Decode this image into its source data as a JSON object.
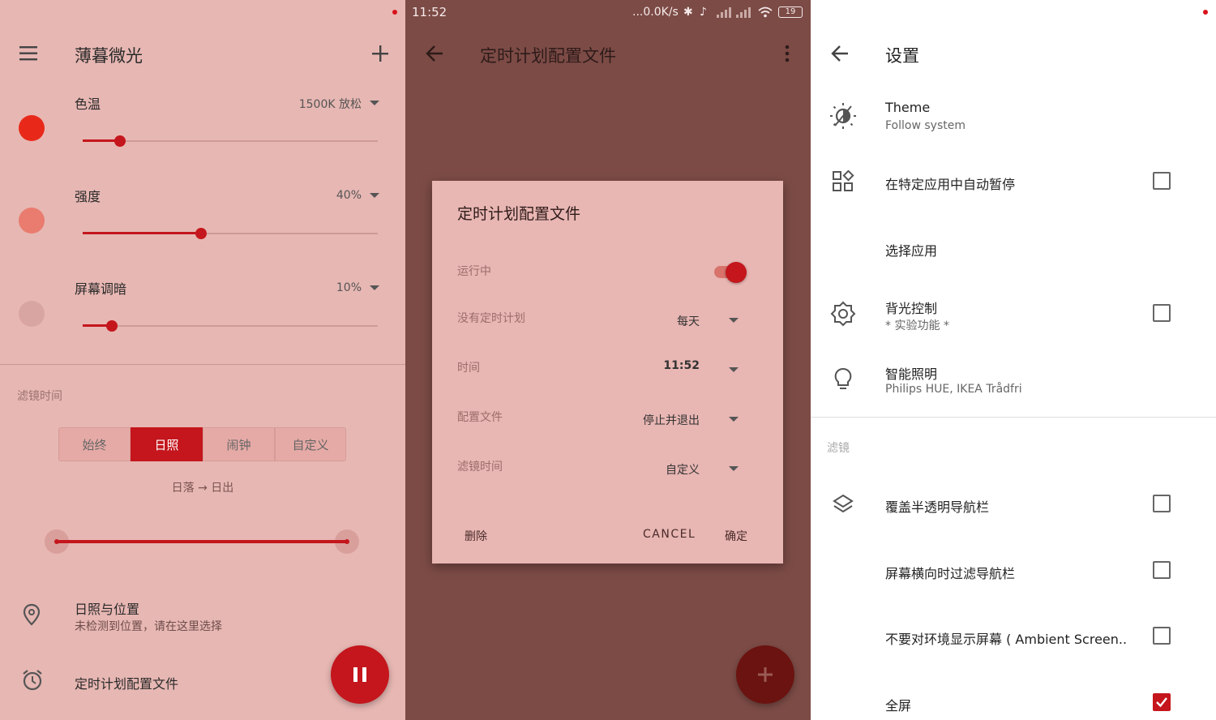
{
  "p1": {
    "title": "薄暮微光",
    "sliders": [
      {
        "label": "色温",
        "value": "1500K 放松",
        "level": 0.125,
        "color": "#e8291a"
      },
      {
        "label": "强度",
        "value": "40%",
        "level": 0.4,
        "color": "#e97c6f"
      },
      {
        "label": "屏幕调暗",
        "value": "10%",
        "level": 0.1,
        "color": "#d9a5a2"
      }
    ],
    "filter_time_label": "滤镜时间",
    "segments": [
      "始终",
      "日照",
      "闹钟",
      "自定义"
    ],
    "selected_segment": "日照",
    "range_text": "日落 → 日出",
    "location_title": "日照与位置",
    "location_sub": "未检测到位置，请在这里选择",
    "schedule_title": "定时计划配置文件"
  },
  "p2": {
    "status": {
      "time": "11:52",
      "net": "...0.0K/s",
      "battery": "19"
    },
    "title": "定时计划配置文件",
    "dialog": {
      "title": "定时计划配置文件",
      "rows": [
        {
          "label": "运行中",
          "value": ""
        },
        {
          "label": "没有定时计划",
          "value": "每天"
        },
        {
          "label": "时间",
          "value": "11:52"
        },
        {
          "label": "配置文件",
          "value": "停止并退出"
        },
        {
          "label": "滤镜时间",
          "value": "自定义"
        }
      ],
      "delete": "删除",
      "cancel": "CANCEL",
      "ok": "确定"
    }
  },
  "p3": {
    "title": "设置",
    "items": [
      {
        "main": "Theme",
        "sub": "Follow system"
      },
      {
        "main": "在特定应用中自动暂停",
        "sub": ""
      },
      {
        "main": "选择应用",
        "sub": ""
      },
      {
        "main": "背光控制",
        "sub": "* 实验功能 *"
      },
      {
        "main": "智能照明",
        "sub": "Philips HUE, IKEA Trådfri"
      }
    ],
    "section": "滤镜",
    "items2": [
      {
        "main": "覆盖半透明导航栏"
      },
      {
        "main": "屏幕横向时过滤导航栏"
      },
      {
        "main": "不要对环境显示屏幕 ( Ambient Screen.."
      },
      {
        "main": "全屏"
      }
    ]
  },
  "colors": {
    "accent": "#c4161c"
  }
}
